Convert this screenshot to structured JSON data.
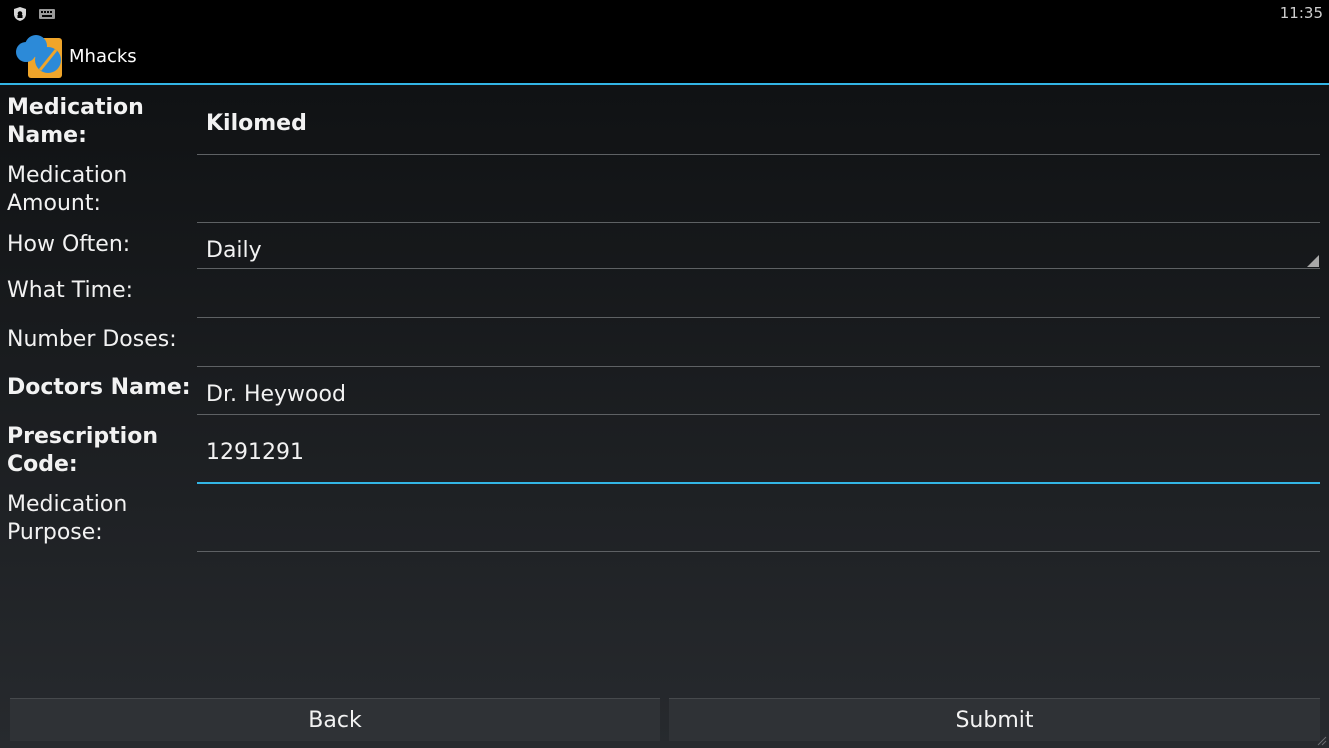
{
  "status_bar": {
    "time": "11:35",
    "icons": [
      "shield-icon",
      "keyboard-icon"
    ]
  },
  "app": {
    "title": "Mhacks",
    "logo_icon": "pill-logo-icon",
    "accent_color": "#33b5e5"
  },
  "form": {
    "medication_name": {
      "label": "Medication Name:",
      "value": "Kilomed"
    },
    "medication_amount": {
      "label": "Medication Amount:",
      "value": ""
    },
    "how_often": {
      "label": "How Often:",
      "value": "Daily"
    },
    "what_time": {
      "label": "What Time:",
      "value": ""
    },
    "number_doses": {
      "label": "Number Doses:",
      "value": ""
    },
    "doctors_name": {
      "label": "Doctors Name:",
      "value": "Dr. Heywood"
    },
    "prescription_code": {
      "label": "Prescription Code:",
      "value": "1291291"
    },
    "medication_purpose": {
      "label": "Medication Purpose:",
      "value": ""
    }
  },
  "buttons": {
    "back": "Back",
    "submit": "Submit"
  }
}
